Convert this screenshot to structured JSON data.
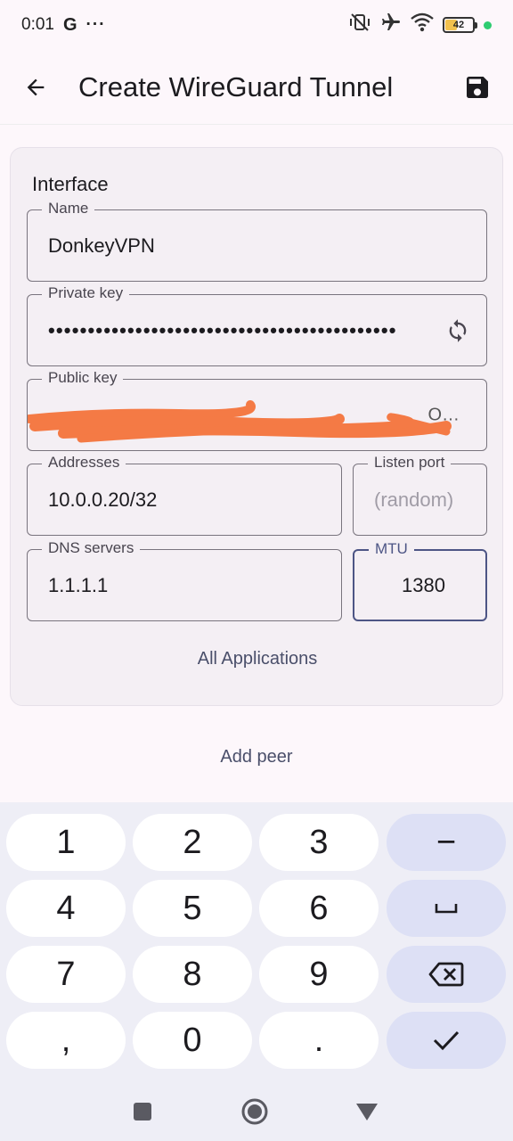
{
  "status_bar": {
    "time": "0:01",
    "g_icon_text": "G",
    "more_dots": "···",
    "battery_level": "42",
    "battery_fraction": 0.42
  },
  "app_bar": {
    "title": "Create WireGuard Tunnel"
  },
  "interface": {
    "section_title": "Interface",
    "name": {
      "label": "Name",
      "value": "DonkeyVPN"
    },
    "private_key": {
      "label": "Private key",
      "value": "••••••••••••••••••••••••••••••••••••••••••••"
    },
    "public_key": {
      "label": "Public key",
      "value": "O…"
    },
    "addresses": {
      "label": "Addresses",
      "value": "10.0.0.20/32"
    },
    "listen_port": {
      "label": "Listen port",
      "placeholder": "(random)"
    },
    "dns_servers": {
      "label": "DNS servers",
      "value": "1.1.1.1"
    },
    "mtu": {
      "label": "MTU",
      "value": "1380"
    },
    "all_applications": "All Applications"
  },
  "add_peer": "Add peer",
  "keyboard": {
    "keys": [
      "1",
      "2",
      "3",
      "−",
      "4",
      "5",
      "6",
      "␣",
      "7",
      "8",
      "9",
      "⌫",
      ",",
      "0",
      ".",
      "✓"
    ]
  },
  "colors": {
    "accent": "#4d5585",
    "card_bg": "#f4eff4",
    "keyboard_bg": "#eeeef6",
    "action_key_bg": "#dde0f5",
    "redaction": "#f47a45"
  }
}
